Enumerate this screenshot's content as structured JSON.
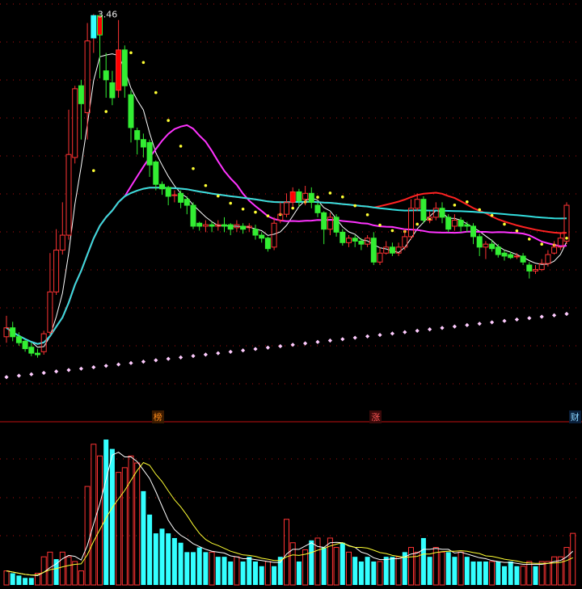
{
  "chart_data": {
    "type": "candlestick",
    "peak_label": "3.46",
    "markers": [
      {
        "label": "榜",
        "candle": 24,
        "color": "#ff8c1a",
        "bg": "#3a1a00"
      },
      {
        "label": "涨",
        "candle": 59,
        "color": "#ff5555",
        "bg": "#3a0a0a"
      },
      {
        "label": "财",
        "candle": 91,
        "color": "#8ad4ff",
        "bg": "#0a1f3a"
      }
    ],
    "colors": {
      "up": "#ff3333",
      "down": "#33ee33",
      "up_fill_big": "#ff0000",
      "cyan_bar": "#33ffff",
      "ma_white": "#ffffff",
      "ma_magenta": "#ff33ff",
      "ma_red": "#ff2222",
      "ma_cyan": "#33dddd",
      "dots_yellow": "#ffff33",
      "dots_pink": "#ffccff",
      "grid": "#b01010",
      "divider": "#c01010"
    },
    "candles": [
      [
        1.3,
        1.36,
        1.44,
        1.26
      ],
      [
        1.36,
        1.3,
        1.4,
        1.27
      ],
      [
        1.3,
        1.26,
        1.33,
        1.24
      ],
      [
        1.27,
        1.22,
        1.28,
        1.2
      ],
      [
        1.23,
        1.19,
        1.26,
        1.17
      ],
      [
        1.19,
        1.18,
        1.22,
        1.16
      ],
      [
        1.2,
        1.32,
        1.34,
        1.18
      ],
      [
        1.33,
        1.6,
        1.86,
        1.31
      ],
      [
        1.6,
        1.88,
        2.02,
        1.58
      ],
      [
        1.88,
        1.98,
        2.2,
        1.85
      ],
      [
        1.98,
        2.52,
        2.82,
        1.95
      ],
      [
        2.5,
        2.96,
        2.98,
        2.46
      ],
      [
        2.98,
        2.86,
        3.02,
        2.62
      ],
      [
        2.8,
        3.28,
        3.4,
        2.62
      ],
      [
        3.3,
        3.45,
        3.46,
        3.2
      ],
      [
        3.45,
        3.32,
        3.36,
        3.03
      ],
      [
        3.08,
        3.02,
        3.2,
        2.9
      ],
      [
        3.0,
        2.9,
        3.08,
        2.85
      ],
      [
        2.95,
        3.22,
        3.42,
        2.9
      ],
      [
        3.22,
        2.98,
        3.25,
        2.9
      ],
      [
        2.92,
        2.7,
        2.95,
        2.6
      ],
      [
        2.68,
        2.62,
        2.7,
        2.52
      ],
      [
        2.62,
        2.57,
        2.66,
        2.5
      ],
      [
        2.6,
        2.45,
        2.62,
        2.37
      ],
      [
        2.47,
        2.32,
        2.48,
        2.28
      ],
      [
        2.32,
        2.29,
        2.34,
        2.25
      ],
      [
        2.3,
        2.24,
        2.31,
        2.18
      ],
      [
        2.25,
        2.25,
        2.28,
        2.2
      ],
      [
        2.26,
        2.2,
        2.28,
        2.16
      ],
      [
        2.22,
        2.18,
        2.24,
        2.12
      ],
      [
        2.18,
        2.04,
        2.2,
        2.02
      ],
      [
        2.06,
        2.04,
        2.07,
        2.01
      ],
      [
        2.04,
        2.05,
        2.08,
        2.0
      ],
      [
        2.05,
        2.04,
        2.07,
        2.0
      ],
      [
        2.04,
        2.05,
        2.08,
        2.01
      ],
      [
        2.05,
        2.04,
        2.1,
        2.0
      ],
      [
        2.05,
        2.02,
        2.06,
        1.98
      ],
      [
        2.03,
        2.05,
        2.08,
        2.0
      ],
      [
        2.04,
        2.02,
        2.06,
        1.99
      ],
      [
        2.03,
        2.04,
        2.06,
        2.0
      ],
      [
        2.02,
        1.98,
        2.05,
        1.95
      ],
      [
        1.98,
        1.96,
        2.0,
        1.93
      ],
      [
        1.96,
        1.89,
        1.97,
        1.87
      ],
      [
        1.9,
        2.06,
        2.1,
        1.88
      ],
      [
        2.08,
        2.12,
        2.2,
        2.06
      ],
      [
        2.12,
        2.2,
        2.26,
        2.1
      ],
      [
        2.2,
        2.27,
        2.3,
        2.17
      ],
      [
        2.27,
        2.21,
        2.29,
        2.17
      ],
      [
        2.22,
        2.26,
        2.31,
        2.18
      ],
      [
        2.26,
        2.2,
        2.3,
        2.16
      ],
      [
        2.18,
        2.13,
        2.2,
        2.1
      ],
      [
        2.13,
        2.02,
        2.14,
        1.92
      ],
      [
        2.02,
        2.1,
        2.13,
        1.98
      ],
      [
        2.1,
        2.0,
        2.12,
        1.97
      ],
      [
        2.0,
        1.93,
        2.02,
        1.91
      ],
      [
        1.93,
        1.96,
        1.98,
        1.9
      ],
      [
        1.96,
        1.94,
        1.98,
        1.9
      ],
      [
        1.94,
        1.92,
        1.96,
        1.88
      ],
      [
        1.92,
        1.96,
        1.98,
        1.9
      ],
      [
        1.96,
        1.8,
        2.0,
        1.78
      ],
      [
        1.8,
        1.86,
        1.9,
        1.78
      ],
      [
        1.86,
        1.9,
        1.94,
        1.85
      ],
      [
        1.9,
        1.86,
        1.93,
        1.84
      ],
      [
        1.86,
        1.9,
        1.93,
        1.84
      ],
      [
        1.9,
        1.97,
        2.02,
        1.88
      ],
      [
        1.97,
        2.16,
        2.22,
        1.95
      ],
      [
        2.16,
        2.22,
        2.26,
        2.14
      ],
      [
        2.22,
        2.08,
        2.24,
        2.06
      ],
      [
        2.08,
        2.1,
        2.14,
        2.06
      ],
      [
        2.1,
        2.16,
        2.2,
        2.08
      ],
      [
        2.16,
        2.1,
        2.2,
        2.06
      ],
      [
        2.1,
        2.02,
        2.12,
        2.0
      ],
      [
        2.04,
        2.08,
        2.12,
        2.01
      ],
      [
        2.08,
        2.04,
        2.1,
        2.0
      ],
      [
        2.05,
        2.04,
        2.07,
        2.0
      ],
      [
        2.04,
        1.97,
        2.06,
        1.92
      ],
      [
        1.97,
        1.9,
        1.99,
        1.84
      ],
      [
        1.9,
        1.92,
        1.94,
        1.82
      ],
      [
        1.92,
        1.89,
        1.95,
        1.87
      ],
      [
        1.9,
        1.85,
        1.92,
        1.83
      ],
      [
        1.86,
        1.84,
        1.88,
        1.81
      ],
      [
        1.85,
        1.83,
        1.87,
        1.82
      ],
      [
        1.84,
        1.84,
        1.86,
        1.82
      ],
      [
        1.84,
        1.8,
        1.86,
        1.78
      ],
      [
        1.78,
        1.74,
        1.8,
        1.69
      ],
      [
        1.74,
        1.75,
        1.78,
        1.72
      ],
      [
        1.75,
        1.79,
        1.82,
        1.74
      ],
      [
        1.79,
        1.85,
        1.88,
        1.77
      ],
      [
        1.86,
        1.9,
        1.94,
        1.85
      ],
      [
        1.9,
        1.96,
        2.0,
        1.88
      ],
      [
        1.94,
        2.18,
        2.2,
        1.92
      ]
    ],
    "volume": [
      [
        6,
        1
      ],
      [
        5,
        0
      ],
      [
        4,
        0
      ],
      [
        3,
        0
      ],
      [
        3,
        0
      ],
      [
        5,
        1
      ],
      [
        12,
        1
      ],
      [
        14,
        1
      ],
      [
        11,
        0
      ],
      [
        14,
        1
      ],
      [
        12,
        1
      ],
      [
        10,
        1
      ],
      [
        6,
        1
      ],
      [
        42,
        1
      ],
      [
        60,
        1
      ],
      [
        55,
        1
      ],
      [
        62,
        0
      ],
      [
        58,
        0
      ],
      [
        48,
        1
      ],
      [
        50,
        1
      ],
      [
        55,
        1
      ],
      [
        52,
        1
      ],
      [
        40,
        0
      ],
      [
        30,
        0
      ],
      [
        22,
        0
      ],
      [
        24,
        0
      ],
      [
        22,
        0
      ],
      [
        20,
        0
      ],
      [
        18,
        0
      ],
      [
        14,
        0
      ],
      [
        14,
        0
      ],
      [
        16,
        0
      ],
      [
        14,
        0
      ],
      [
        14,
        1
      ],
      [
        12,
        0
      ],
      [
        12,
        0
      ],
      [
        10,
        0
      ],
      [
        12,
        1
      ],
      [
        10,
        0
      ],
      [
        12,
        0
      ],
      [
        10,
        0
      ],
      [
        8,
        0
      ],
      [
        10,
        1
      ],
      [
        8,
        0
      ],
      [
        12,
        0
      ],
      [
        28,
        1
      ],
      [
        18,
        1
      ],
      [
        10,
        0
      ],
      [
        15,
        1
      ],
      [
        19,
        0
      ],
      [
        20,
        1
      ],
      [
        16,
        0
      ],
      [
        20,
        1
      ],
      [
        16,
        1
      ],
      [
        18,
        0
      ],
      [
        14,
        1
      ],
      [
        12,
        0
      ],
      [
        10,
        0
      ],
      [
        12,
        0
      ],
      [
        10,
        0
      ],
      [
        10,
        1
      ],
      [
        12,
        0
      ],
      [
        12,
        0
      ],
      [
        12,
        1
      ],
      [
        14,
        0
      ],
      [
        16,
        1
      ],
      [
        14,
        1
      ],
      [
        20,
        0
      ],
      [
        12,
        0
      ],
      [
        16,
        1
      ],
      [
        14,
        1
      ],
      [
        14,
        0
      ],
      [
        12,
        0
      ],
      [
        14,
        1
      ],
      [
        12,
        0
      ],
      [
        10,
        0
      ],
      [
        10,
        0
      ],
      [
        10,
        0
      ],
      [
        10,
        1
      ],
      [
        10,
        0
      ],
      [
        8,
        0
      ],
      [
        10,
        0
      ],
      [
        8,
        0
      ],
      [
        8,
        1
      ],
      [
        10,
        1
      ],
      [
        8,
        0
      ],
      [
        10,
        1
      ],
      [
        10,
        1
      ],
      [
        12,
        1
      ],
      [
        12,
        1
      ],
      [
        16,
        1
      ],
      [
        22,
        1
      ]
    ]
  }
}
